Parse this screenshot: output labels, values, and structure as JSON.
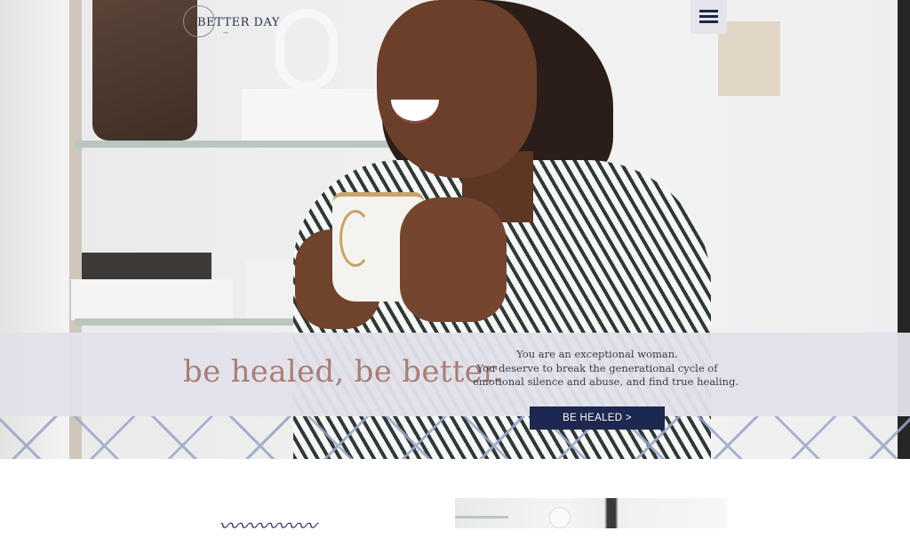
{
  "header": {
    "logo_text": "BETTER DAY",
    "menu_icon": "hamburger-menu-icon"
  },
  "hero": {
    "headline": "be healed, be better.",
    "blurb": [
      "You are an exceptional woman.",
      "You deserve to break the generational cycle of",
      "emotional silence and abuse, and find true healing."
    ],
    "cta_label": "BE HEALED >",
    "band_color": "#e2e1e9",
    "headline_color": "#a87d78",
    "cta_color": "#1c2850"
  }
}
